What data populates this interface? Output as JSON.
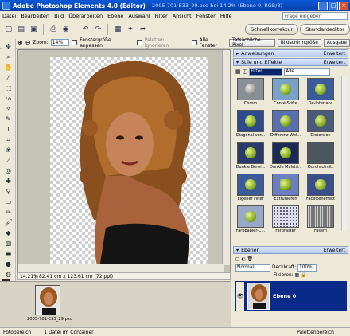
{
  "window": {
    "app_title": "Adobe Photoshop Elements 4.0 (Editor)",
    "doc_title": "2005-701-E33_29.psd bei 14.2% (Ebene 0, RGB/8)"
  },
  "menu": {
    "items": [
      "Datei",
      "Bearbeiten",
      "Bild",
      "Überarbeiten",
      "Ebene",
      "Auswahl",
      "Filter",
      "Ansicht",
      "Fenster",
      "Hilfe"
    ],
    "help_placeholder": "Frage eingeben"
  },
  "modes": {
    "quick": "Schnellkorrektur",
    "standard": "Standardeditor"
  },
  "options": {
    "zoom_label": "Zoom:",
    "zoom_value": "14%",
    "fit_window": "Fenstergröße anpassen",
    "ignore_palettes": "Paletten ignorieren",
    "all_windows": "Alle Fenster",
    "actual_pixels": "Tatsächliche Pixel",
    "fit_screen": "Bildschirmgröße",
    "print_size": "Ausgabe"
  },
  "status": {
    "zoom": "14.21%",
    "dimensions": "82.41 cm x 123.61 cm (72 ppi)"
  },
  "bin": {
    "caption": "2005-701-E33_29.psd"
  },
  "bottom": {
    "photo_bin": "Fotobereich",
    "container": "1 Datei im Container",
    "palette_bin": "Palettenbereich"
  },
  "palettes": {
    "instructions": "Anweisungen",
    "styles": "Stile und Effekte",
    "advanced": "Erweitert",
    "filter_dropdown": "Filter",
    "all_dropdown": "Alle",
    "effects": [
      {
        "label": "Chrom"
      },
      {
        "label": "Conté-Stifte"
      },
      {
        "label": "De-Interlace"
      },
      {
        "label": "Diagonal ver..."
      },
      {
        "label": "Differenz-Wol..."
      },
      {
        "label": "Distorsion"
      },
      {
        "label": "Dunkle Berei..."
      },
      {
        "label": "Dunkle Malstri..."
      },
      {
        "label": "Durchschnitt"
      },
      {
        "label": "Eigener Filter"
      },
      {
        "label": "Extrudieren"
      },
      {
        "label": "Facetteneffekt"
      },
      {
        "label": "Farbpapier-C..."
      },
      {
        "label": "Farbraster"
      },
      {
        "label": "Fasern"
      }
    ],
    "layers_title": "Ebenen",
    "blend_mode": "Normal",
    "opacity_label": "Deckkraft:",
    "opacity_value": "100%",
    "lock_label": "Fixieren:",
    "layer_name": "Ebene 0"
  },
  "colors": {
    "title_bar": "#0a58d8",
    "selected_layer": "#0a2a8a"
  }
}
